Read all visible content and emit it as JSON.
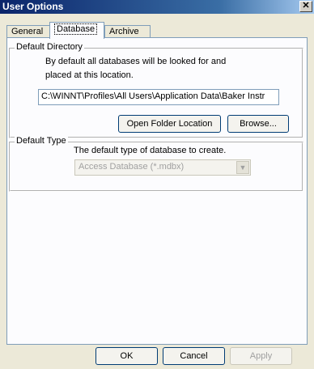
{
  "window": {
    "title": "User Options",
    "close_glyph": "✕"
  },
  "tabs": [
    {
      "label": "General"
    },
    {
      "label": "Database"
    },
    {
      "label": "Archive"
    }
  ],
  "default_directory": {
    "legend": "Default Directory",
    "description_line1": "By default all databases will be looked for and",
    "description_line2": "placed at this location.",
    "path_value": "C:\\WINNT\\Profiles\\All Users\\Application Data\\Baker Instr",
    "open_folder_label": "Open Folder Location",
    "browse_label": "Browse..."
  },
  "default_type": {
    "legend": "Default Type",
    "description": "The default type of database to create.",
    "selected_value": "Access Database (*.mdbx)"
  },
  "footer": {
    "ok_label": "OK",
    "cancel_label": "Cancel",
    "apply_label": "Apply"
  }
}
